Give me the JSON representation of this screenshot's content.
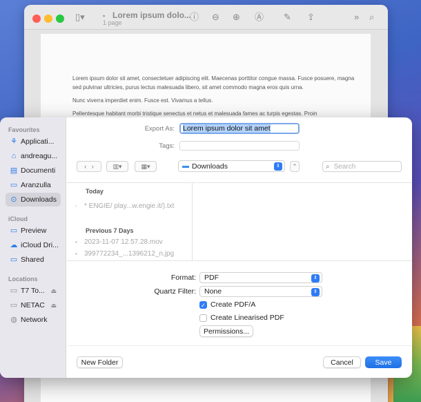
{
  "preview": {
    "title": "Lorem ipsum dolo...",
    "subtitle": "1 page",
    "paragraphs": [
      "Lorem ipsum dolor sit amet, consectetuer adipiscing elit. Maecenas porttitor congue massa. Fusce posuere, magna sed pulvinar ultricies, purus lectus malesuada libero, sit amet commodo magna eros quis urna.",
      "Nunc viverra imperdiet enim. Fusce est. Vivamus a tellus.",
      "Pellentesque habitant morbi tristique senectus et netus et malesuada fames ac turpis egestas. Proin"
    ]
  },
  "sidebar": {
    "sections": {
      "favourites": "Favourites",
      "icloud": "iCloud",
      "locations": "Locations"
    },
    "favourites": [
      {
        "label": "Applicati...",
        "icon": "applications-icon"
      },
      {
        "label": "andreagu...",
        "icon": "home-icon"
      },
      {
        "label": "Documenti",
        "icon": "document-icon"
      },
      {
        "label": "Aranzulla",
        "icon": "folder-icon"
      },
      {
        "label": "Downloads",
        "icon": "download-icon"
      }
    ],
    "icloud": [
      {
        "label": "Preview",
        "icon": "folder-icon"
      },
      {
        "label": "iCloud Dri...",
        "icon": "cloud-icon"
      },
      {
        "label": "Shared",
        "icon": "shared-folder-icon"
      }
    ],
    "locations": [
      {
        "label": "T7 To...",
        "icon": "drive-icon"
      },
      {
        "label": "NETAC",
        "icon": "drive-icon"
      },
      {
        "label": "Network",
        "icon": "network-icon"
      }
    ]
  },
  "export": {
    "export_as_label": "Export As:",
    "filename": "Lorem ipsum dolor sit amet",
    "tags_label": "Tags:",
    "tags_value": ""
  },
  "toolbar": {
    "location": "Downloads",
    "search_placeholder": "Search"
  },
  "files": {
    "today_label": "Today",
    "today": [
      {
        "name": "* ENGIE/ play...w.engie.it/).txt"
      }
    ],
    "week_label": "Previous 7 Days",
    "week": [
      {
        "name": "2023-11-07 12.57.28.mov"
      },
      {
        "name": "399772234_...1396212_n.jpg"
      }
    ]
  },
  "options": {
    "format_label": "Format:",
    "format_value": "PDF",
    "quartz_label": "Quartz Filter:",
    "quartz_value": "None",
    "create_pdfa_label": "Create PDF/A",
    "create_pdfa_checked": true,
    "create_linearised_label": "Create Linearised PDF",
    "create_linearised_checked": false,
    "permissions_label": "Permissions..."
  },
  "buttons": {
    "new_folder": "New Folder",
    "cancel": "Cancel",
    "save": "Save"
  },
  "colors": {
    "accent": "#2f7cf6",
    "selection": "#b3d3fb"
  }
}
